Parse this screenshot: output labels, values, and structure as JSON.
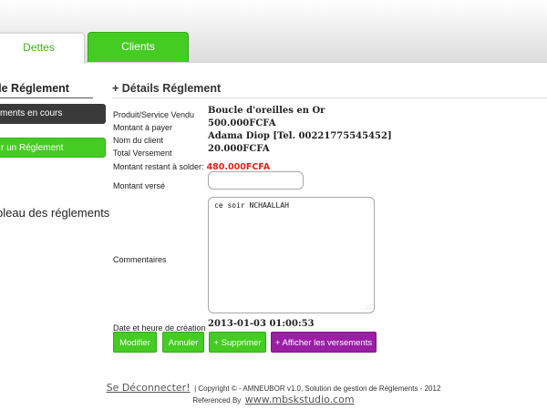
{
  "tabs": {
    "dettes": "Dettes",
    "clients": "Clients"
  },
  "sidebar": {
    "heading": "de Réglement",
    "btn_en_cours": "ments en cours",
    "btn_ajouter": "r un Réglement",
    "link_tableau": "bleau des réglements"
  },
  "main": {
    "heading": "+ Détails Réglement",
    "fields": {
      "produit": {
        "label": "Produit/Service Vendu",
        "value": "Boucle d'oreilles en Or"
      },
      "montant": {
        "label": "Montant à payer",
        "value": "500.000FCFA"
      },
      "client": {
        "label": "Nom du client",
        "value": "Adama Diop [Tel. 00221775545452]"
      },
      "versement": {
        "label": "Total Versement",
        "value": "20.000FCFA"
      },
      "restant": {
        "label": "Montant restant à solder:",
        "value": "480.000FCFA"
      }
    },
    "montant_verse": {
      "label": "Montant versé",
      "value": ""
    },
    "commentaires": {
      "label": "Commentaires",
      "value": "ce soir NCHAALLAH"
    },
    "date_creation": {
      "label": "Date et heure de création",
      "value": "2013-01-03 01:00:53"
    }
  },
  "buttons": {
    "modifier": "Modifier",
    "annuler": "Annuler",
    "supprimer": "+ Supprimer",
    "afficher": "+ Afficher les versements"
  },
  "footer": {
    "logout": "Se Déconnecter!",
    "copyright": "| Copyright © - AMNEUBOR v1.0, Solution de gestion de Réglements - 2012",
    "referenced": "Referenced By",
    "site": "www.mbskstudio.com"
  },
  "colors": {
    "green": "#44cc22",
    "purple": "#9a1fa5",
    "red": "#e3241b",
    "dark": "#3a3a3a"
  }
}
